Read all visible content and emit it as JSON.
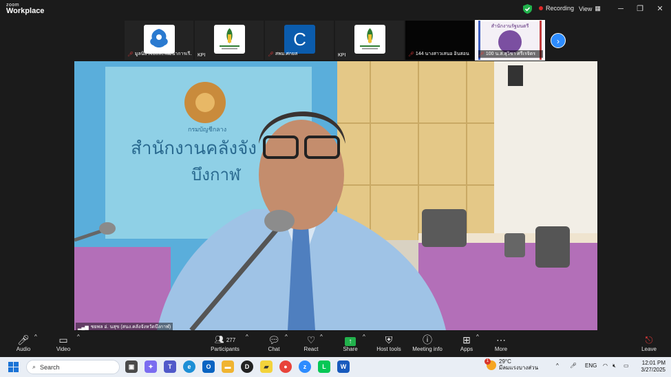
{
  "app": {
    "logo_line1": "zoom",
    "logo_line2": "Workplace"
  },
  "titlebar": {
    "recording_label": "Recording",
    "view_label": "View",
    "shield_icon": "shield-check-icon",
    "status_color": "#22b14c"
  },
  "thumbnails": [
    {
      "label": "มูลนิธิวิจัยและพัฒนาการเรี...",
      "avatar": "garuda-emblem",
      "muted": true
    },
    {
      "label": "KPI",
      "avatar": "kpi-logo",
      "muted": false
    },
    {
      "label": "สพม.ศกยส",
      "avatar_letter": "C",
      "muted": true
    },
    {
      "label": "KPI",
      "avatar": "kpi-logo",
      "muted": false
    },
    {
      "label": "144 นางสาวเสนอ อินสอน",
      "avatar": "none",
      "muted": true
    },
    {
      "label": "100 น.ส.สุวิชา ศรีเรจิตร",
      "avatar": "parliament-logo",
      "avatar_text": "สำนักงานรัฐมนตรี",
      "muted": true
    }
  ],
  "main_video": {
    "speaker_label": "ชยพล อ่. นสุข (สนง.คลังจังหวัดบึงกาฬ)",
    "wall_sign_line1": "สำนักงานคลังจัง",
    "wall_sign_line2": "บึงกาฬ",
    "wall_sign_small": "กรมบัญชีกลาง"
  },
  "toolbar": {
    "audio": "Audio",
    "video": "Video",
    "participants": "Participants",
    "participants_count": "277",
    "chat": "Chat",
    "react": "React",
    "share": "Share",
    "host_tools": "Host tools",
    "meeting_info": "Meeting info",
    "apps": "Apps",
    "more": "More",
    "leave": "Leave"
  },
  "taskbar": {
    "search_placeholder": "Search",
    "weather_temp": "29°C",
    "weather_desc": "มีลมแรงบางส่วน",
    "weather_badge": "1",
    "lang": "ENG",
    "time": "12:01 PM",
    "date": "3/27/2025"
  }
}
